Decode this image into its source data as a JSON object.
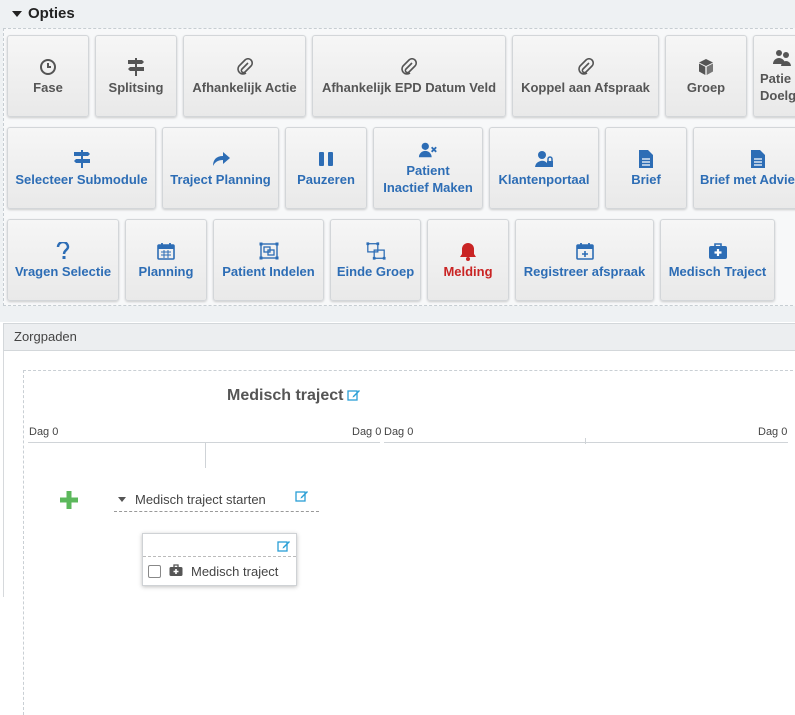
{
  "opties": {
    "title": "Opties",
    "row1": [
      {
        "label": "Fase",
        "icon": "clock-icon"
      },
      {
        "label": "Splitsing",
        "icon": "signpost-icon"
      },
      {
        "label": "Afhankelijk Actie",
        "icon": "paperclip-icon"
      },
      {
        "label": "Afhankelijk EPD Datum Veld",
        "icon": "paperclip-icon"
      },
      {
        "label": "Koppel aan Afspraak",
        "icon": "paperclip-icon"
      },
      {
        "label": "Groep",
        "icon": "cube-icon"
      },
      {
        "label1": "Patie",
        "label2": "Doelg",
        "icon": "users-icon"
      }
    ],
    "row2": [
      {
        "label": "Selecteer Submodule",
        "icon": "signpost-icon"
      },
      {
        "label": "Traject Planning",
        "icon": "share-arrow-icon"
      },
      {
        "label": "Pauzeren",
        "icon": "pause-icon"
      },
      {
        "label1": "Patient",
        "label2": "Inactief Maken",
        "icon": "user-remove-icon"
      },
      {
        "label": "Klantenportaal",
        "icon": "user-lock-icon"
      },
      {
        "label": "Brief",
        "icon": "document-icon"
      },
      {
        "label": "Brief met Advie",
        "icon": "document-icon"
      }
    ],
    "row3": [
      {
        "label": "Vragen Selectie",
        "icon": "question-icon"
      },
      {
        "label": "Planning",
        "icon": "calendar-icon"
      },
      {
        "label": "Patient Indelen",
        "icon": "object-group-icon"
      },
      {
        "label": "Einde Groep",
        "icon": "object-ungroup-icon"
      },
      {
        "label": "Melding",
        "icon": "bell-icon"
      },
      {
        "label": "Registreer afspraak",
        "icon": "calendar-plus-icon"
      },
      {
        "label": "Medisch Traject",
        "icon": "medkit-icon"
      }
    ]
  },
  "zorgpaden": {
    "header": "Zorgpaden",
    "traject_title": "Medisch traject",
    "timeline": {
      "left_start": "Dag 0",
      "left_end": "Dag 0",
      "right_start": "Dag 0",
      "right_end": "Dag 0"
    },
    "step": {
      "label": "Medisch traject starten"
    },
    "card": {
      "item_label": "Medisch traject"
    }
  },
  "colors": {
    "accent": "#2d6db5",
    "alert": "#c92424",
    "add": "#5cb85c",
    "edit": "#2a9fd6"
  }
}
